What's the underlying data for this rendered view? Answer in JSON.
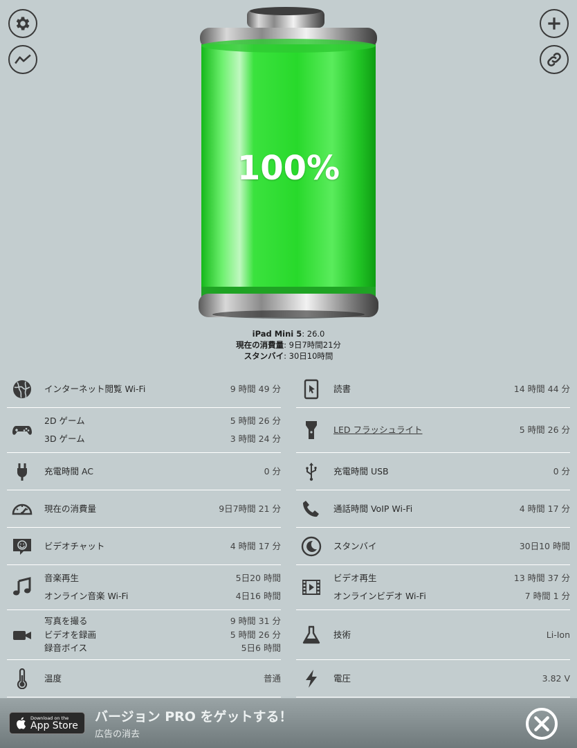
{
  "battery": {
    "percent": "100%",
    "level": 1.0,
    "color": "#28d92b"
  },
  "device": {
    "name": "iPad Mini 5",
    "version": ": 26.0",
    "usage_label": "現在の消費量",
    "usage_value": ": 9日7時間21分",
    "standby_label": "スタンバイ",
    "standby_value": ": 30日10時間"
  },
  "left_rows": [
    {
      "icon": "globe-icon",
      "lines": [
        {
          "label": "インターネット閲覧 Wi-Fi",
          "value": "9 時間 49 分"
        }
      ]
    },
    {
      "icon": "gamepad-icon",
      "lines": [
        {
          "label": "2D ゲーム",
          "value": "5 時間 26 分"
        },
        {
          "label": "3D ゲーム",
          "value": "3 時間 24 分"
        }
      ]
    },
    {
      "icon": "plug-icon",
      "lines": [
        {
          "label": "充電時間 AC",
          "value": "0 分"
        }
      ]
    },
    {
      "icon": "speedometer-icon",
      "lines": [
        {
          "label": "現在の消費量",
          "value": "9日7時間 21 分"
        }
      ]
    },
    {
      "icon": "video-chat-icon",
      "lines": [
        {
          "label": "ビデオチャット",
          "value": "4 時間 17 分"
        }
      ]
    },
    {
      "icon": "music-note-icon",
      "lines": [
        {
          "label": "音楽再生",
          "value": "5日20 時間"
        },
        {
          "label": "オンライン音楽 Wi-Fi",
          "value": "4日16 時間"
        }
      ]
    },
    {
      "icon": "video-camera-icon",
      "lines": [
        {
          "label": "写真を撮る",
          "value": "9 時間 31 分"
        },
        {
          "label": "ビデオを録画",
          "value": "5 時間 26 分"
        },
        {
          "label": "録音ボイス",
          "value": "5日6 時間"
        }
      ]
    },
    {
      "icon": "thermometer-icon",
      "lines": [
        {
          "label": "温度",
          "value": "普通"
        }
      ]
    }
  ],
  "right_rows": [
    {
      "icon": "tablet-icon",
      "lines": [
        {
          "label": "読書",
          "value": "14 時間 44 分"
        }
      ]
    },
    {
      "icon": "flashlight-icon",
      "lines": [
        {
          "label": "LED フラッシュライト",
          "value": "5 時間 26 分"
        }
      ]
    },
    {
      "icon": "usb-icon",
      "lines": [
        {
          "label": "充電時間 USB",
          "value": "0 分"
        }
      ]
    },
    {
      "icon": "phone-icon",
      "lines": [
        {
          "label": "通話時間 VoIP Wi-Fi",
          "value": "4 時間 17 分"
        }
      ]
    },
    {
      "icon": "moon-icon",
      "lines": [
        {
          "label": "スタンバイ",
          "value": "30日10 時間"
        }
      ]
    },
    {
      "icon": "film-icon",
      "lines": [
        {
          "label": "ビデオ再生",
          "value": "13 時間 37 分"
        },
        {
          "label": "オンラインビデオ Wi-Fi",
          "value": "7 時間 1 分"
        }
      ]
    },
    {
      "icon": "flask-icon",
      "lines": [
        {
          "label": "技術",
          "value": "Li-Ion"
        }
      ]
    },
    {
      "icon": "lightning-icon",
      "lines": [
        {
          "label": "電圧",
          "value": "3.82 V"
        }
      ]
    }
  ],
  "ad": {
    "store_small": "Download on the",
    "store_big": "App Store",
    "title": "バージョン PRO をゲットする！",
    "subtitle": "広告の消去"
  }
}
